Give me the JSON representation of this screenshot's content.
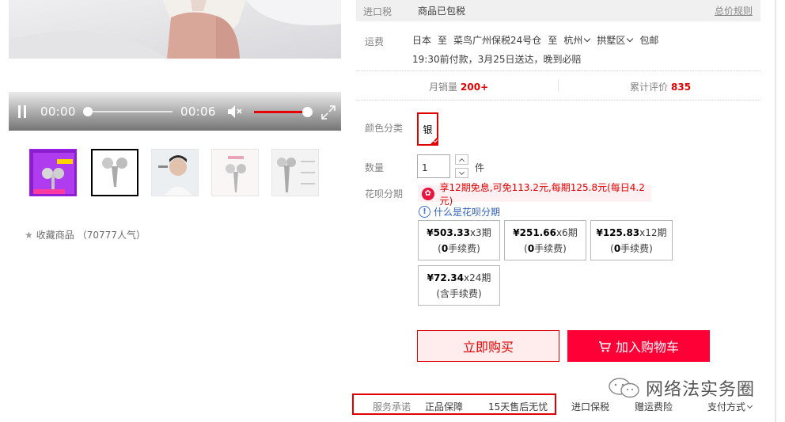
{
  "video": {
    "current_time": "00:00",
    "duration": "00:06",
    "progress_fraction": 0.0,
    "volume_fraction": 1.0
  },
  "thumbnails": [
    {
      "name": "thumb-1"
    },
    {
      "name": "thumb-2",
      "active": true
    },
    {
      "name": "thumb-3"
    },
    {
      "name": "thumb-4"
    },
    {
      "name": "thumb-5"
    }
  ],
  "favorite": {
    "label": "收藏商品",
    "count": "（70777人气）"
  },
  "tax": {
    "label": "进口税",
    "value": "商品已包税",
    "link": "总价规则"
  },
  "shipping": {
    "label": "运费",
    "from": "日本",
    "to_word": "至",
    "warehouse": "菜鸟广州保税24号仓",
    "to_word2": "至",
    "city": "杭州",
    "district": "拱墅区",
    "free": "包邮",
    "delivery": "19:30前付款，3月25日送达，晚到必赔"
  },
  "stats": {
    "monthly_sales_label": "月销量",
    "monthly_sales_value": "200+",
    "reviews_label": "累计评价",
    "reviews_value": "835"
  },
  "sku": {
    "label": "颜色分类",
    "selected": "银"
  },
  "quantity": {
    "label": "数量",
    "value": "1",
    "unit": "件"
  },
  "huabei": {
    "label": "花呗分期",
    "icon": "huabei-icon",
    "banner": "享12期免息,可免113.2元,每期125.8元(每日4.2元)",
    "what_link": "什么是花呗分期",
    "plans": [
      {
        "price": "¥503.33",
        "term": "x3期",
        "fee_prefix": "(",
        "fee_bold": "0",
        "fee_rest": "手续费)"
      },
      {
        "price": "¥251.66",
        "term": "x6期",
        "fee_prefix": "(",
        "fee_bold": "0",
        "fee_rest": "手续费)"
      },
      {
        "price": "¥125.83",
        "term": "x12期",
        "fee_prefix": "(",
        "fee_bold": "0",
        "fee_rest": "手续费)"
      },
      {
        "price": "¥72.34",
        "term": "x24期",
        "fee_prefix": "(",
        "fee_bold": "",
        "fee_rest": "含手续费)"
      }
    ]
  },
  "buttons": {
    "buy_now": "立即购买",
    "add_to_cart": "加入购物车"
  },
  "watermark": "网络法实务圈",
  "footer": {
    "promise_label": "服务承诺",
    "genuine": "正品保障",
    "after_sales": "15天售后无忧",
    "bonded": "进口保税",
    "shipping_insurance": "赠运费险",
    "payment": "支付方式"
  },
  "colors": {
    "accent": "#e10000",
    "cart": "#ff0036",
    "link": "#2f60b8"
  }
}
